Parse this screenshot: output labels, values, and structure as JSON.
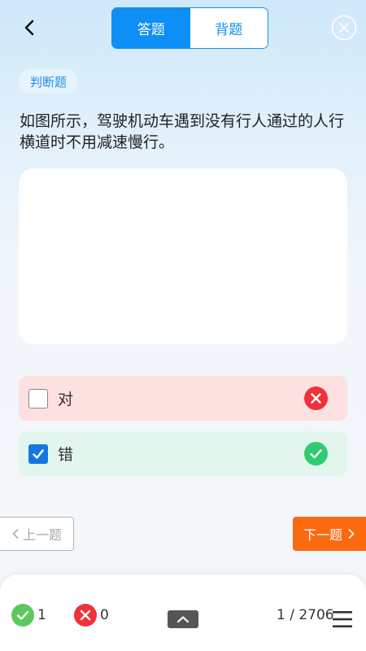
{
  "header": {
    "tabs": [
      {
        "label": "答题",
        "active": true
      },
      {
        "label": "背题",
        "active": false
      }
    ]
  },
  "question": {
    "type": "判断题",
    "text": "如图所示，驾驶机动车遇到没有行人通过的人行横道时不用减速慢行。",
    "options": [
      {
        "label": "对",
        "checked": false,
        "result": "wrong"
      },
      {
        "label": "错",
        "checked": true,
        "result": "correct"
      }
    ]
  },
  "nav": {
    "prev_label": "上一题",
    "next_label": "下一题"
  },
  "footer": {
    "correct_count": "1",
    "wrong_count": "0",
    "progress": "1 / 2706"
  },
  "colors": {
    "primary": "#0e8ff5",
    "next_button": "#fa6a10",
    "correct": "#2ecc71",
    "wrong": "#f0313a"
  },
  "icons": [
    "chevron-left-icon",
    "close-circle-icon",
    "cross-icon",
    "check-icon",
    "chevron-up-icon",
    "menu-icon"
  ]
}
